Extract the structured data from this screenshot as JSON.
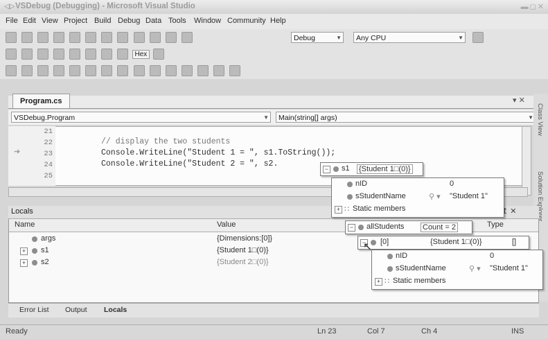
{
  "window": {
    "title": "VSDebug (Debugging) - Microsoft Visual Studio"
  },
  "menu": [
    "File",
    "Edit",
    "View",
    "Project",
    "Build",
    "Debug",
    "Data",
    "Tools",
    "Window",
    "Community",
    "Help"
  ],
  "toolbar": {
    "config": "Debug",
    "platform": "Any CPU",
    "hex_label": "Hex"
  },
  "editor": {
    "tab": "Program.cs",
    "class_combo": "VSDebug.Program",
    "method_combo": "Main(string[] args)",
    "lines": [
      {
        "num": "21",
        "text": ""
      },
      {
        "num": "22",
        "text": "// display the two students"
      },
      {
        "num": "23",
        "text": "Console.WriteLine(\"Student 1 = \", s1.ToString());"
      },
      {
        "num": "24",
        "text": "Console.WriteLine(\"Student 2 = \", s2."
      },
      {
        "num": "25",
        "text": ""
      }
    ]
  },
  "tooltip1": {
    "header": {
      "name": "s1",
      "value": "{Student 1□(0)}"
    },
    "rows": [
      {
        "name": "nID",
        "value": "0"
      },
      {
        "name": "sStudentName",
        "value": "\"Student 1\""
      },
      {
        "name": "Static members",
        "value": ""
      }
    ]
  },
  "tooltip2": {
    "header": {
      "name": "allStudents",
      "value": "Count = 2"
    },
    "item": {
      "name": "[0]",
      "value": "{Student 1□(0)}",
      "type": "[]"
    },
    "rows": [
      {
        "name": "nID",
        "value": "0"
      },
      {
        "name": "sStudentName",
        "value": "\"Student 1\""
      },
      {
        "name": "Static members",
        "value": ""
      }
    ]
  },
  "locals": {
    "title": "Locals",
    "columns": {
      "name": "Name",
      "value": "Value",
      "type": "Type"
    },
    "rows": [
      {
        "name": "args",
        "value": "{Dimensions:[0]}"
      },
      {
        "name": "s1",
        "value": "{Student 1□(0)}"
      },
      {
        "name": "s2",
        "value": "{Student 2□(0)}"
      }
    ]
  },
  "sidebar": {
    "class_view": "Class View",
    "solution_explorer": "Solution Explorer"
  },
  "bottom_tabs": [
    "Error List",
    "Output",
    "Locals"
  ],
  "status": {
    "ready": "Ready",
    "ln": "Ln 23",
    "col": "Col 7",
    "ch": "Ch 4",
    "ins": "INS"
  }
}
